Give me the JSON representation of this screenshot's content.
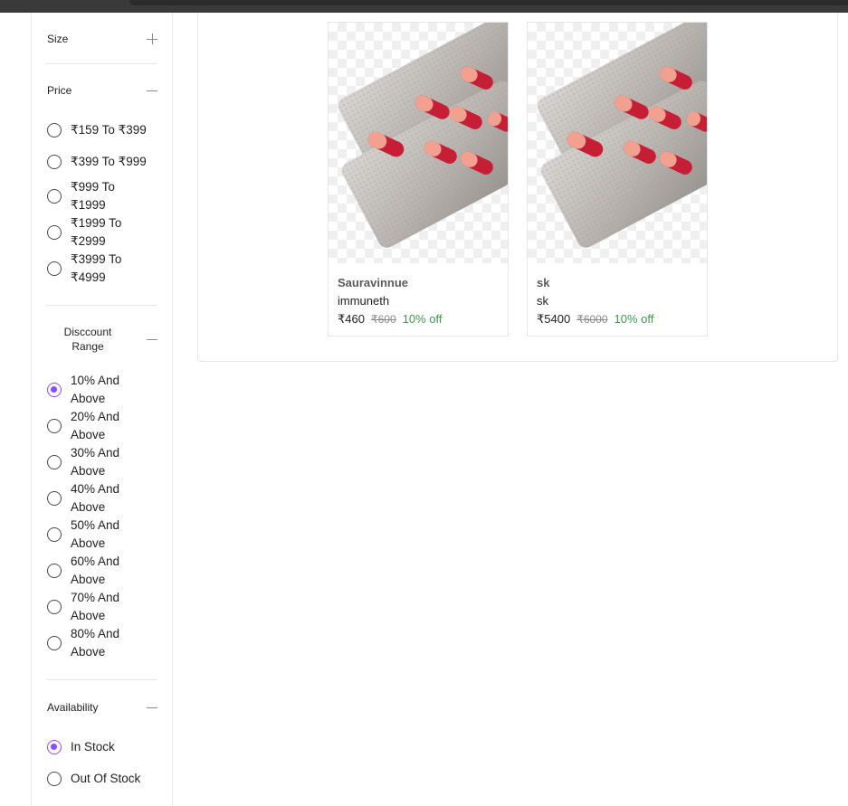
{
  "filters": {
    "size": {
      "label": "Size"
    },
    "price": {
      "label": "Price",
      "options": [
        "₹159 To ₹399",
        "₹399 To ₹999",
        "₹999 To ₹1999",
        "₹1999 To ₹2999",
        "₹3999 To ₹4999"
      ]
    },
    "discount": {
      "label": "Disccount Range",
      "options": [
        "10% And Above",
        "20% And Above",
        "30% And Above",
        "40% And Above",
        "50% And Above",
        "60% And Above",
        "70% And Above",
        "80% And Above"
      ],
      "selected": "10% And Above"
    },
    "availability": {
      "label": "Availability",
      "options": [
        "In Stock",
        "Out Of Stock"
      ],
      "selected": "In Stock"
    }
  },
  "products": [
    {
      "name": "Sauravinnue",
      "subtitle": "immuneth",
      "price": "₹460",
      "mrp": "₹600",
      "discount": "10% off"
    },
    {
      "name": "sk",
      "subtitle": "sk",
      "price": "₹5400",
      "mrp": "₹6000",
      "discount": "10% off"
    }
  ],
  "colors": {
    "accent": "#8c4bff",
    "discount_green": "#3a9b4e"
  }
}
